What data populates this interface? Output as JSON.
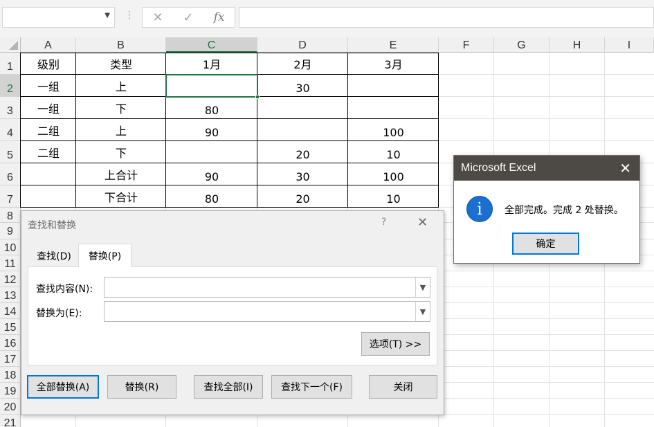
{
  "formula_bar": {
    "name_box_value": "",
    "cancel_icon": "✕",
    "enter_icon": "✓",
    "fx_label": "fx",
    "formula_value": ""
  },
  "columns": [
    "A",
    "B",
    "C",
    "D",
    "E",
    "F",
    "G",
    "H",
    "I"
  ],
  "rows": [
    "1",
    "2",
    "3",
    "4",
    "5",
    "6",
    "7",
    "8",
    "9",
    "10",
    "11",
    "12",
    "13",
    "14",
    "15",
    "16",
    "17",
    "18",
    "19",
    "20",
    "21"
  ],
  "selected": {
    "column": "C",
    "row": "2"
  },
  "table": {
    "header": [
      "级别",
      "类型",
      "1月",
      "2月",
      "3月"
    ],
    "body": [
      [
        "一组",
        "上",
        "",
        "30",
        ""
      ],
      [
        "一组",
        "下",
        "80",
        "",
        ""
      ],
      [
        "二组",
        "上",
        "90",
        "",
        "100"
      ],
      [
        "二组",
        "下",
        "",
        "20",
        "10"
      ],
      [
        "",
        "上合计",
        "90",
        "30",
        "100"
      ],
      [
        "",
        "下合计",
        "80",
        "20",
        "10"
      ]
    ]
  },
  "find_dialog": {
    "title": "查找和替换",
    "help": "?",
    "close": "✕",
    "tabs": [
      {
        "label": "查找(D)",
        "active": false
      },
      {
        "label": "替换(P)",
        "active": true
      }
    ],
    "find_label": "查找内容(N):",
    "find_value": "",
    "replace_label": "替换为(E):",
    "replace_value": "",
    "options_button": "选项(T) >>",
    "buttons": [
      "全部替换(A)",
      "替换(R)",
      "查找全部(I)",
      "查找下一个(F)",
      "关闭"
    ]
  },
  "message_box": {
    "title": "Microsoft Excel",
    "close": "✕",
    "icon_glyph": "i",
    "message": "全部完成。完成 2 处替换。",
    "ok_button": "确定"
  },
  "colors": {
    "excel_green": "#217346",
    "focus_blue": "#0078d7",
    "info_blue": "#1a6fd0",
    "msg_titlebar": "#4d4944"
  }
}
